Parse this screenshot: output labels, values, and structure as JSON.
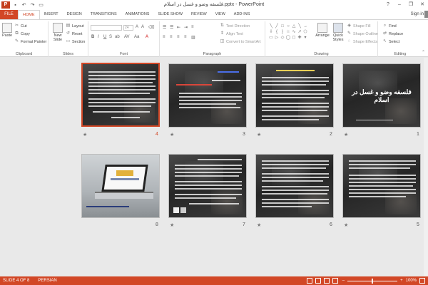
{
  "title": "فلسفه وضو و غسل در اسلام.pptx - PowerPoint",
  "titlebar": {
    "app_icon": "P",
    "save_icon": "save-icon",
    "undo_icon": "undo-icon",
    "redo_icon": "redo-icon",
    "present_icon": "present-icon",
    "help": "?",
    "minimize": "–",
    "restore": "❐",
    "close": "✕"
  },
  "tabs": {
    "file": "FILE",
    "items": [
      "HOME",
      "INSERT",
      "DESIGN",
      "TRANSITIONS",
      "ANIMATIONS",
      "SLIDE SHOW",
      "REVIEW",
      "VIEW",
      "ADD-INS"
    ],
    "active": "HOME",
    "signin": "Sign in"
  },
  "ribbon": {
    "clipboard": {
      "label": "Clipboard",
      "paste": "Paste",
      "cut": "Cut",
      "copy": "Copy",
      "format_painter": "Format Painter"
    },
    "slides": {
      "label": "Slides",
      "new_slide": "New Slide",
      "layout": "Layout",
      "reset": "Reset",
      "section": "Section"
    },
    "font": {
      "label": "Font",
      "size": "24"
    },
    "paragraph": {
      "label": "Paragraph",
      "text_direction": "Text Direction",
      "align_text": "Align Text",
      "convert_smartart": "Convert to SmartArt"
    },
    "drawing": {
      "label": "Drawing",
      "arrange": "Arrange",
      "quick_styles": "Quick Styles",
      "shape_fill": "Shape Fill",
      "shape_outline": "Shape Outline",
      "shape_effects": "Shape Effects"
    },
    "editing": {
      "label": "Editing",
      "find": "Find",
      "replace": "Replace",
      "select": "Select"
    }
  },
  "slides": [
    {
      "number": "1",
      "title": "فلسفه وضو و غسل در اسلام",
      "selected": false,
      "star": "★"
    },
    {
      "number": "2",
      "title": "",
      "selected": false,
      "star": "★"
    },
    {
      "number": "3",
      "title": "",
      "selected": false,
      "star": "★"
    },
    {
      "number": "4",
      "title": "",
      "selected": true,
      "star": "★"
    },
    {
      "number": "5",
      "title": "",
      "selected": false,
      "star": "★"
    },
    {
      "number": "6",
      "title": "",
      "selected": false,
      "star": "★"
    },
    {
      "number": "7",
      "title": "",
      "selected": false,
      "star": "★"
    },
    {
      "number": "8",
      "title": "",
      "selected": false,
      "star": ""
    }
  ],
  "status": {
    "slide_info": "SLIDE 4 OF 8",
    "language": "PERSIAN",
    "zoom": "100%",
    "zoom_level": 1.0
  },
  "colors": {
    "accent": "#d24726",
    "selected_border": "#d24726"
  }
}
